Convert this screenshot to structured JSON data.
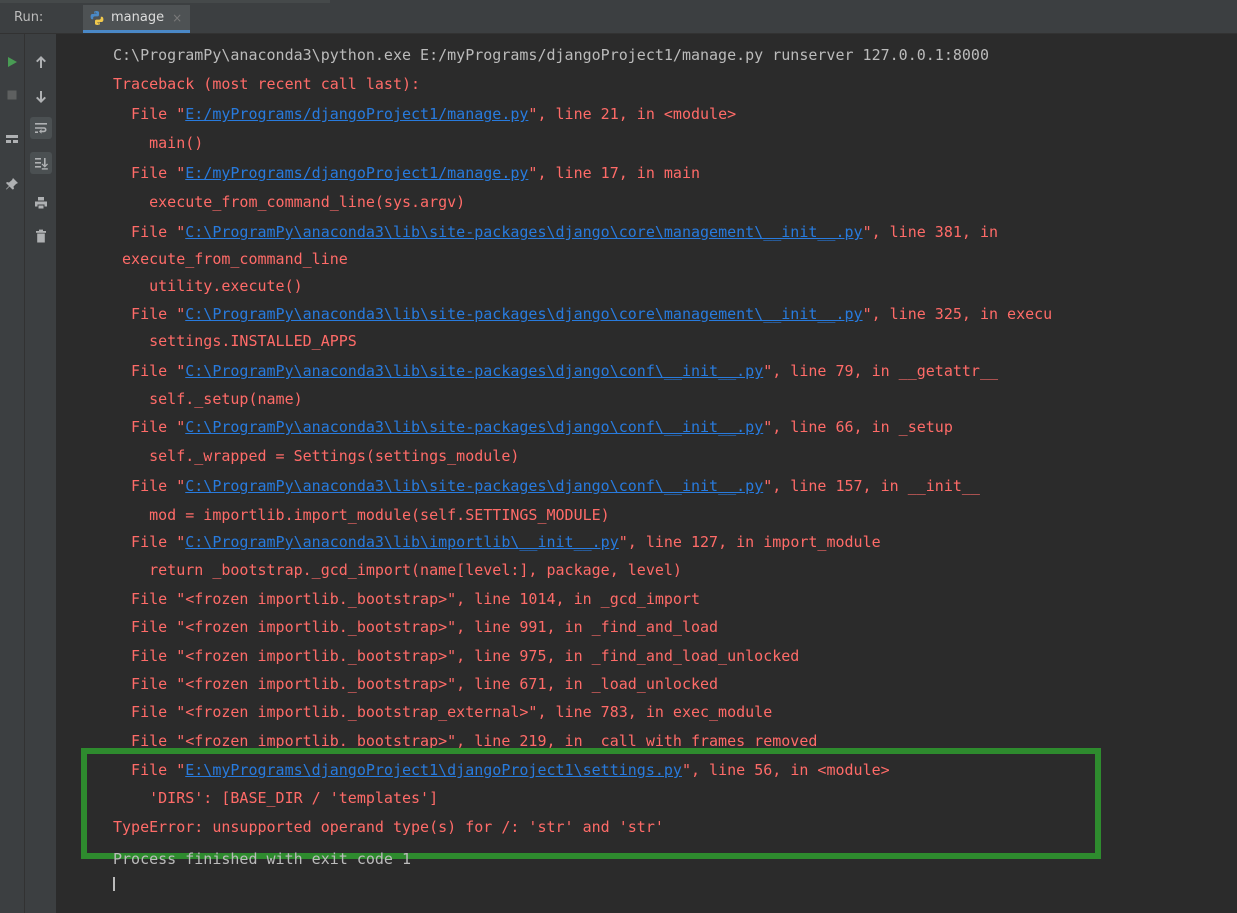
{
  "panel": {
    "run_label": "Run:",
    "tab_label": "manage",
    "tab_close": "×"
  },
  "console": {
    "cmd": "C:\\ProgramPy\\anaconda3\\python.exe E:/myPrograms/djangoProject1/manage.py runserver 127.0.0.1:8000",
    "tb_header": "Traceback (most recent call last):",
    "l1_pre": "  File \"",
    "l1_link": "E:/myPrograms/djangoProject1/manage.py",
    "l1_post": "\", line 21, in <module>",
    "l2": "    main()",
    "l3_pre": "  File \"",
    "l3_link": "E:/myPrograms/djangoProject1/manage.py",
    "l3_post": "\", line 17, in main",
    "l4": "    execute_from_command_line(sys.argv)",
    "l5_pre": "  File \"",
    "l5_link": "C:\\ProgramPy\\anaconda3\\lib\\site-packages\\django\\core\\management\\__init__.py",
    "l5_post": "\", line 381, in",
    "l6": " execute_from_command_line",
    "l7": "    utility.execute()",
    "l8_pre": "  File \"",
    "l8_link": "C:\\ProgramPy\\anaconda3\\lib\\site-packages\\django\\core\\management\\__init__.py",
    "l8_post": "\", line 325, in execu",
    "l9": "    settings.INSTALLED_APPS",
    "l10_pre": "  File \"",
    "l10_link": "C:\\ProgramPy\\anaconda3\\lib\\site-packages\\django\\conf\\__init__.py",
    "l10_post": "\", line 79, in __getattr__",
    "l11": "    self._setup(name)",
    "l12_pre": "  File \"",
    "l12_link": "C:\\ProgramPy\\anaconda3\\lib\\site-packages\\django\\conf\\__init__.py",
    "l12_post": "\", line 66, in _setup",
    "l13": "    self._wrapped = Settings(settings_module)",
    "l14_pre": "  File \"",
    "l14_link": "C:\\ProgramPy\\anaconda3\\lib\\site-packages\\django\\conf\\__init__.py",
    "l14_post": "\", line 157, in __init__",
    "l15": "    mod = importlib.import_module(self.SETTINGS_MODULE)",
    "l16_pre": "  File \"",
    "l16_link": "C:\\ProgramPy\\anaconda3\\lib\\importlib\\__init__.py",
    "l16_post": "\", line 127, in import_module",
    "l17": "    return _bootstrap._gcd_import(name[level:], package, level)",
    "l18": "  File \"<frozen importlib._bootstrap>\", line 1014, in _gcd_import",
    "l19": "  File \"<frozen importlib._bootstrap>\", line 991, in _find_and_load",
    "l20": "  File \"<frozen importlib._bootstrap>\", line 975, in _find_and_load_unlocked",
    "l21": "  File \"<frozen importlib._bootstrap>\", line 671, in _load_unlocked",
    "l22": "  File \"<frozen importlib._bootstrap_external>\", line 783, in exec_module",
    "l23": "  File \"<frozen importlib._bootstrap>\", line 219, in _call_with_frames_removed",
    "l24_pre": "  File \"",
    "l24_link": "E:\\myPrograms\\djangoProject1\\djangoProject1\\settings.py",
    "l24_post": "\", line 56, in <module>",
    "l25": "    'DIRS': [BASE_DIR / 'templates']",
    "l26": "TypeError: unsupported operand type(s) for /: 'str' and 'str'",
    "exit_msg": "Process finished with exit code 1"
  },
  "colors": {
    "error_text": "#ff6b68",
    "normal_text": "#bbbbbb",
    "link": "#287bde",
    "highlight_border": "#2e8b2e",
    "background": "#2b2b2b"
  }
}
